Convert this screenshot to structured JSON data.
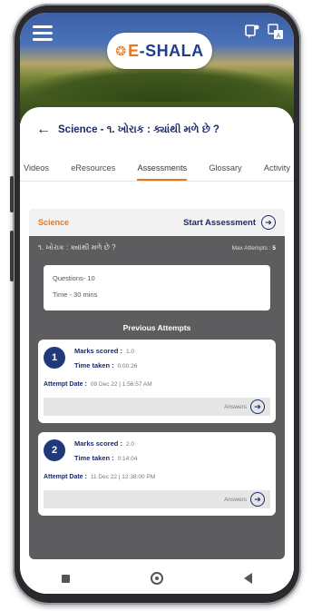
{
  "header": {
    "logo": {
      "mark": "❂",
      "text_prefix": "",
      "text_e": "E",
      "text_rest": "-SHALA"
    }
  },
  "page": {
    "title": "Science - ૧. ખોરાક : ક્યાંથી મળે છે ?"
  },
  "tabs": [
    {
      "label": "Videos",
      "active": false
    },
    {
      "label": "eResources",
      "active": false
    },
    {
      "label": "Assessments",
      "active": true
    },
    {
      "label": "Glossary",
      "active": false
    },
    {
      "label": "Activity",
      "active": false
    }
  ],
  "assessment": {
    "subject": "Science",
    "start_label": "Start Assessment",
    "chapter_title": "૧. ખોરાક : ક્યાંથી મળે છે ?",
    "max_attempts_label": "Max Attempts :",
    "max_attempts_value": "5",
    "questions": "Questions- 10",
    "time": "Time - 30 mins",
    "previous_attempts_title": "Previous Attempts"
  },
  "attempts": [
    {
      "number": "1",
      "marks_label": "Marks scored :",
      "marks_value": "1.0",
      "time_label": "Time taken :",
      "time_value": "0:00:26",
      "date_label": "Attempt Date :",
      "date_value": "09 Dec 22 | 1:56:57 AM",
      "answers_label": "Answers"
    },
    {
      "number": "2",
      "marks_label": "Marks scored :",
      "marks_value": "2.0",
      "time_label": "Time taken :",
      "time_value": "0:14:04",
      "date_label": "Attempt Date :",
      "date_value": "11 Dec 22 | 12:38:00 PM",
      "answers_label": "Answers"
    }
  ],
  "colors": {
    "accent": "#e8761c",
    "primary": "#1b2a6b",
    "panel": "#5d5d5f"
  },
  "icons": {
    "menu": "hamburger-menu-icon",
    "notification": "notification-icon",
    "translate": "translate-icon",
    "back": "arrow-left-icon",
    "start": "circle-arrow-right-icon"
  }
}
